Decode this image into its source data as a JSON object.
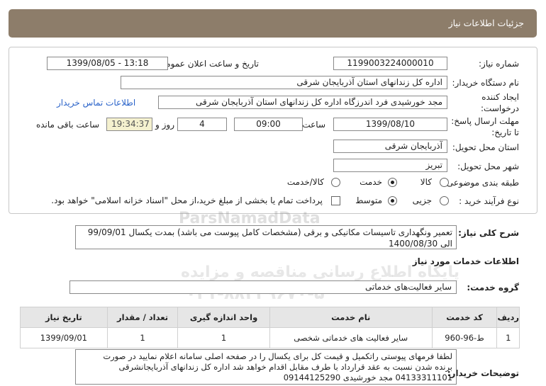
{
  "header": {
    "title": "جزئیات اطلاعات نیاز"
  },
  "fields": {
    "need_number_label": "شماره نیاز:",
    "need_number": "1199003224000010",
    "announce_label": "تاریخ و ساعت اعلان عمومی:",
    "announce_value": "1399/08/05 - 13:18",
    "buyer_label": "نام دستگاه خریدار:",
    "buyer_value": "اداره کل زندانهای استان آذربایجان شرقی",
    "creator_label_1": "ایجاد کننده",
    "creator_label_2": "درخواست:",
    "creator_value": "مجد خورشیدی فرد اندرزگاه اداره کل زندانهای استان آذربایجان شرقی",
    "contact_link": "اطلاعات تماس خریدار",
    "deadline_label_1": "مهلت ارسال پاسخ:",
    "deadline_label_2": "تا تاریخ:",
    "deadline_date": "1399/08/10",
    "time_label": "ساعت",
    "deadline_time": "09:00",
    "days_value": "4",
    "days_label": "روز و",
    "remaining_value": "19:34:37",
    "remaining_label": "ساعت باقی مانده",
    "province_label": "استان محل تحویل:",
    "province_value": "آذربایجان شرقی",
    "city_label": "شهر محل تحویل:",
    "city_value": "تبریز",
    "category_label": "طبقه بندی موضوعی:",
    "category_options": [
      "کالا",
      "خدمت",
      "کالا/خدمت"
    ],
    "category_selected": "خدمت",
    "process_label": "نوع فرآیند خرید :",
    "process_options": [
      "جزیی",
      "متوسط"
    ],
    "process_selected": "متوسط",
    "payment_note": "پرداخت تمام یا بخشی از مبلغ خرید،از محل \"اسناد خزانه اسلامی\" خواهد بود."
  },
  "description": {
    "label": "شرح کلی نیاز:",
    "line1": "تعمیر ونگهداری تاسیسات مکانیکی و برقی (مشخصات کامل پیوست می باشد) بمدت یکسال 99/09/01",
    "line2": "الی 1400/08/30"
  },
  "services_section": {
    "title": "اطلاعات خدمات مورد نیاز"
  },
  "service_group": {
    "label": "گروه خدمت:",
    "value": "سایر فعالیت‌های خدماتی"
  },
  "table": {
    "headers": [
      "ردیف",
      "کد خدمت",
      "نام خدمت",
      "واحد اندازه گیری",
      "تعداد / مقدار",
      "تاریخ نیاز"
    ],
    "rows": [
      [
        "1",
        "ط-96-960",
        "سایر فعالیت های خدماتی شخصی",
        "1",
        "1",
        "1399/09/01"
      ]
    ]
  },
  "notes": {
    "label": "توضیحات خریدار:",
    "line1": "لطفا فرمهای پیوستی راتکمیل و قیمت کل برای یکسال را در صفحه اصلی سامانه اعلام نمایید در صورت",
    "line2": "برنده شدن نسبت به عقد قرارداد با طرف مقابل اقدام خواهد شد اداره کل زندانهای آذربایجانشرقی",
    "line3": "04133311101 مجد خورشیدی 09144125290"
  },
  "watermark": {
    "brand": "ParsNamadData",
    "line1": "پایگاه اطلاع رسانی مناقصه و مزایده",
    "phone": "۰۲۱-۸۸۳۴۹۶۷۰-۵"
  }
}
